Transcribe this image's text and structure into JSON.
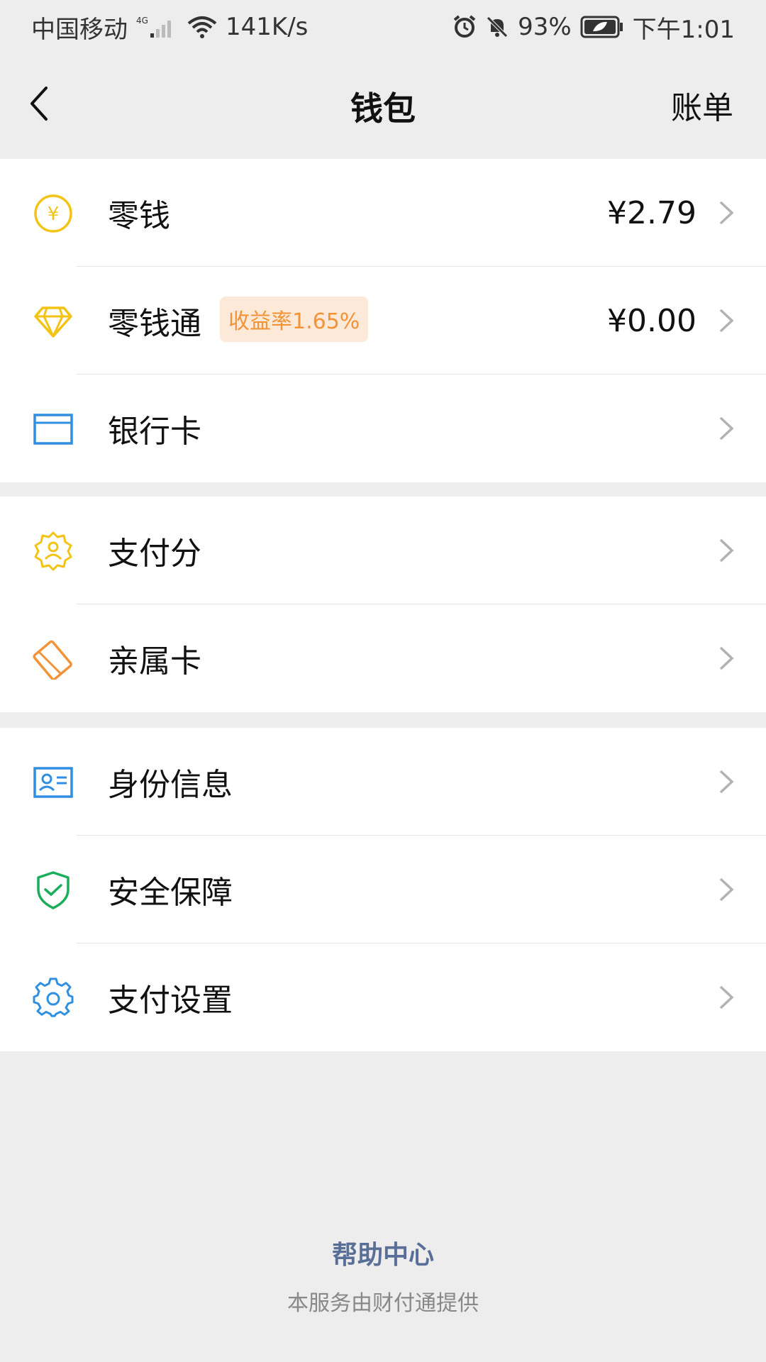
{
  "status_bar": {
    "carrier": "中国移动",
    "network_type": "4G",
    "speed": "141K/s",
    "battery": "93%",
    "time": "下午1:01"
  },
  "nav": {
    "title": "钱包",
    "right_action": "账单"
  },
  "items": {
    "change": {
      "label": "零钱",
      "value": "¥2.79"
    },
    "change_plus": {
      "label": "零钱通",
      "badge": "收益率1.65%",
      "value": "¥0.00"
    },
    "bank_card": {
      "label": "银行卡"
    },
    "pay_score": {
      "label": "支付分"
    },
    "family_card": {
      "label": "亲属卡"
    },
    "identity": {
      "label": "身份信息"
    },
    "security": {
      "label": "安全保障"
    },
    "pay_settings": {
      "label": "支付设置"
    }
  },
  "footer": {
    "help": "帮助中心",
    "note": "本服务由财付通提供"
  },
  "colors": {
    "yellow": "#f3c316",
    "blue": "#2f8fe0",
    "orange": "#f29337",
    "green": "#1aad5a",
    "link": "#5a6f97"
  }
}
